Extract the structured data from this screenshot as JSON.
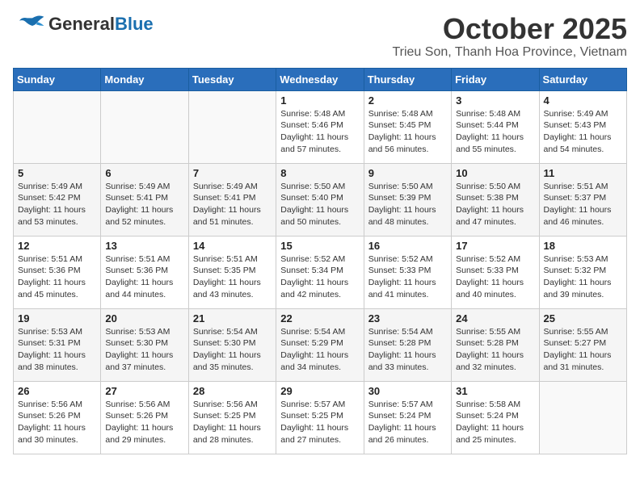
{
  "header": {
    "logo_general": "General",
    "logo_blue": "Blue",
    "month": "October 2025",
    "location": "Trieu Son, Thanh Hoa Province, Vietnam"
  },
  "days_of_week": [
    "Sunday",
    "Monday",
    "Tuesday",
    "Wednesday",
    "Thursday",
    "Friday",
    "Saturday"
  ],
  "weeks": [
    [
      {
        "day": "",
        "info": ""
      },
      {
        "day": "",
        "info": ""
      },
      {
        "day": "",
        "info": ""
      },
      {
        "day": "1",
        "info": "Sunrise: 5:48 AM\nSunset: 5:46 PM\nDaylight: 11 hours\nand 57 minutes."
      },
      {
        "day": "2",
        "info": "Sunrise: 5:48 AM\nSunset: 5:45 PM\nDaylight: 11 hours\nand 56 minutes."
      },
      {
        "day": "3",
        "info": "Sunrise: 5:48 AM\nSunset: 5:44 PM\nDaylight: 11 hours\nand 55 minutes."
      },
      {
        "day": "4",
        "info": "Sunrise: 5:49 AM\nSunset: 5:43 PM\nDaylight: 11 hours\nand 54 minutes."
      }
    ],
    [
      {
        "day": "5",
        "info": "Sunrise: 5:49 AM\nSunset: 5:42 PM\nDaylight: 11 hours\nand 53 minutes."
      },
      {
        "day": "6",
        "info": "Sunrise: 5:49 AM\nSunset: 5:41 PM\nDaylight: 11 hours\nand 52 minutes."
      },
      {
        "day": "7",
        "info": "Sunrise: 5:49 AM\nSunset: 5:41 PM\nDaylight: 11 hours\nand 51 minutes."
      },
      {
        "day": "8",
        "info": "Sunrise: 5:50 AM\nSunset: 5:40 PM\nDaylight: 11 hours\nand 50 minutes."
      },
      {
        "day": "9",
        "info": "Sunrise: 5:50 AM\nSunset: 5:39 PM\nDaylight: 11 hours\nand 48 minutes."
      },
      {
        "day": "10",
        "info": "Sunrise: 5:50 AM\nSunset: 5:38 PM\nDaylight: 11 hours\nand 47 minutes."
      },
      {
        "day": "11",
        "info": "Sunrise: 5:51 AM\nSunset: 5:37 PM\nDaylight: 11 hours\nand 46 minutes."
      }
    ],
    [
      {
        "day": "12",
        "info": "Sunrise: 5:51 AM\nSunset: 5:36 PM\nDaylight: 11 hours\nand 45 minutes."
      },
      {
        "day": "13",
        "info": "Sunrise: 5:51 AM\nSunset: 5:36 PM\nDaylight: 11 hours\nand 44 minutes."
      },
      {
        "day": "14",
        "info": "Sunrise: 5:51 AM\nSunset: 5:35 PM\nDaylight: 11 hours\nand 43 minutes."
      },
      {
        "day": "15",
        "info": "Sunrise: 5:52 AM\nSunset: 5:34 PM\nDaylight: 11 hours\nand 42 minutes."
      },
      {
        "day": "16",
        "info": "Sunrise: 5:52 AM\nSunset: 5:33 PM\nDaylight: 11 hours\nand 41 minutes."
      },
      {
        "day": "17",
        "info": "Sunrise: 5:52 AM\nSunset: 5:33 PM\nDaylight: 11 hours\nand 40 minutes."
      },
      {
        "day": "18",
        "info": "Sunrise: 5:53 AM\nSunset: 5:32 PM\nDaylight: 11 hours\nand 39 minutes."
      }
    ],
    [
      {
        "day": "19",
        "info": "Sunrise: 5:53 AM\nSunset: 5:31 PM\nDaylight: 11 hours\nand 38 minutes."
      },
      {
        "day": "20",
        "info": "Sunrise: 5:53 AM\nSunset: 5:30 PM\nDaylight: 11 hours\nand 37 minutes."
      },
      {
        "day": "21",
        "info": "Sunrise: 5:54 AM\nSunset: 5:30 PM\nDaylight: 11 hours\nand 35 minutes."
      },
      {
        "day": "22",
        "info": "Sunrise: 5:54 AM\nSunset: 5:29 PM\nDaylight: 11 hours\nand 34 minutes."
      },
      {
        "day": "23",
        "info": "Sunrise: 5:54 AM\nSunset: 5:28 PM\nDaylight: 11 hours\nand 33 minutes."
      },
      {
        "day": "24",
        "info": "Sunrise: 5:55 AM\nSunset: 5:28 PM\nDaylight: 11 hours\nand 32 minutes."
      },
      {
        "day": "25",
        "info": "Sunrise: 5:55 AM\nSunset: 5:27 PM\nDaylight: 11 hours\nand 31 minutes."
      }
    ],
    [
      {
        "day": "26",
        "info": "Sunrise: 5:56 AM\nSunset: 5:26 PM\nDaylight: 11 hours\nand 30 minutes."
      },
      {
        "day": "27",
        "info": "Sunrise: 5:56 AM\nSunset: 5:26 PM\nDaylight: 11 hours\nand 29 minutes."
      },
      {
        "day": "28",
        "info": "Sunrise: 5:56 AM\nSunset: 5:25 PM\nDaylight: 11 hours\nand 28 minutes."
      },
      {
        "day": "29",
        "info": "Sunrise: 5:57 AM\nSunset: 5:25 PM\nDaylight: 11 hours\nand 27 minutes."
      },
      {
        "day": "30",
        "info": "Sunrise: 5:57 AM\nSunset: 5:24 PM\nDaylight: 11 hours\nand 26 minutes."
      },
      {
        "day": "31",
        "info": "Sunrise: 5:58 AM\nSunset: 5:24 PM\nDaylight: 11 hours\nand 25 minutes."
      },
      {
        "day": "",
        "info": ""
      }
    ]
  ]
}
